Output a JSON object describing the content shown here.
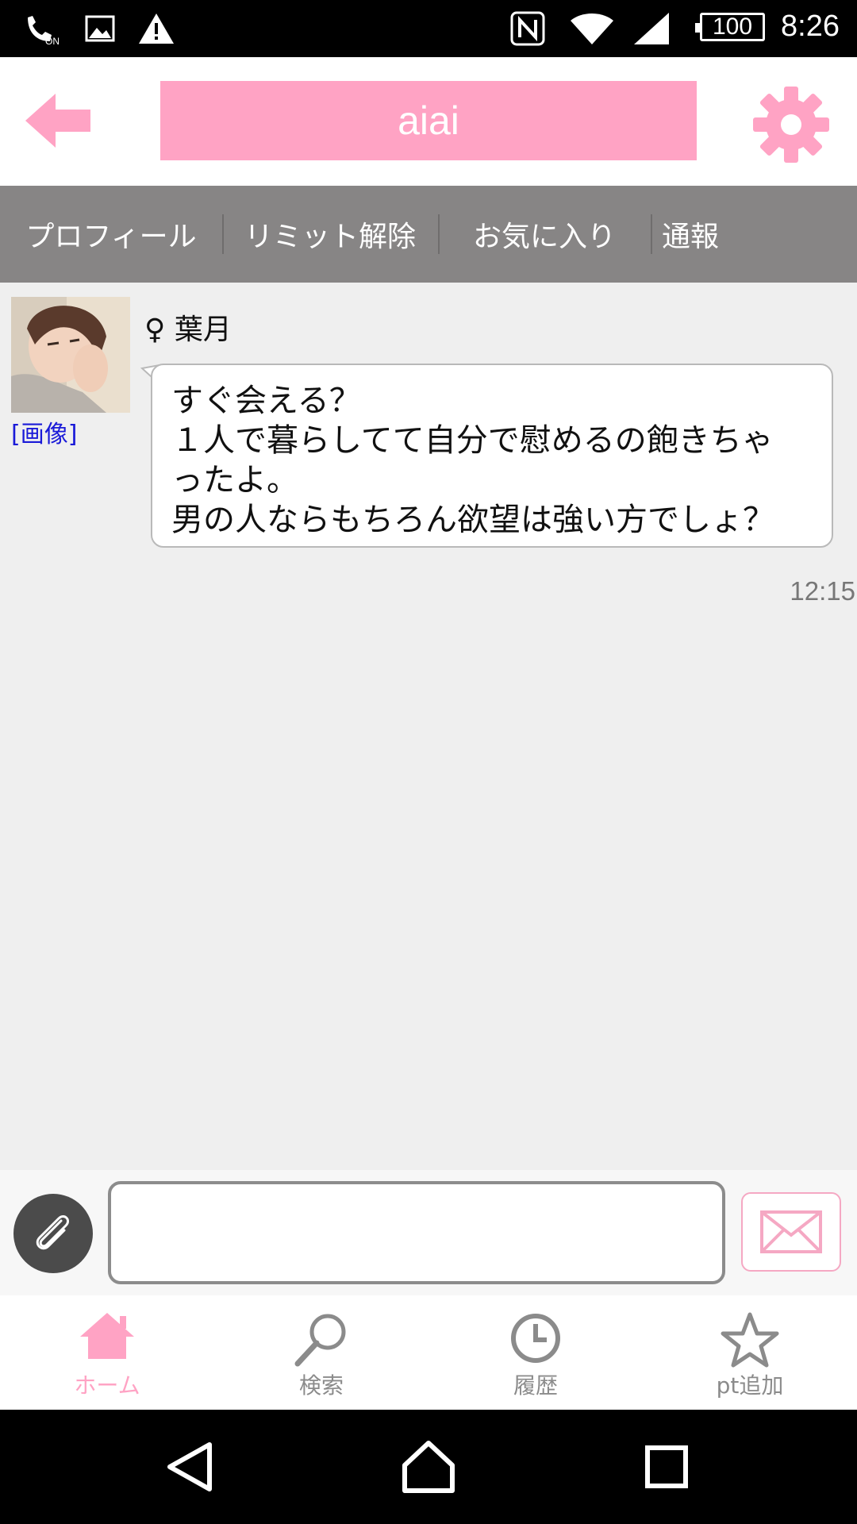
{
  "status_bar": {
    "time": "8:26",
    "battery": "100",
    "icons": [
      "wifi-calling-icon",
      "image-icon",
      "warning-icon",
      "nfc-icon",
      "wifi-icon",
      "signal-icon",
      "battery-icon"
    ]
  },
  "header": {
    "title": "aiai",
    "back_icon": "back-arrow-icon",
    "settings_icon": "gear-icon"
  },
  "tabs": [
    {
      "label": "プロフィール"
    },
    {
      "label": "リミット解除"
    },
    {
      "label": "お気に入り"
    },
    {
      "label": "通報"
    }
  ],
  "message": {
    "sender_symbol": "♀",
    "sender_name": "葉月",
    "image_link": "[画像]",
    "lines": [
      "すぐ会える？",
      "１人で暮らしてて自分で慰めるの飽きちゃ",
      "ったよ。",
      "男の人ならもちろん欲望は強い方でしょ？"
    ],
    "time": "12:15"
  },
  "input_bar": {
    "placeholder": "",
    "attach_icon": "paperclip-icon",
    "send_icon": "envelope-icon"
  },
  "bottom_nav": [
    {
      "label": "ホーム",
      "icon": "home-icon",
      "active": true
    },
    {
      "label": "検索",
      "icon": "search-icon",
      "active": false
    },
    {
      "label": "履歴",
      "icon": "clock-icon",
      "active": false
    },
    {
      "label": "pt追加",
      "icon": "star-icon",
      "active": false
    }
  ],
  "colors": {
    "accent_pink": "#ffa3c4",
    "tab_bar": "#878585",
    "background": "#efefef"
  }
}
